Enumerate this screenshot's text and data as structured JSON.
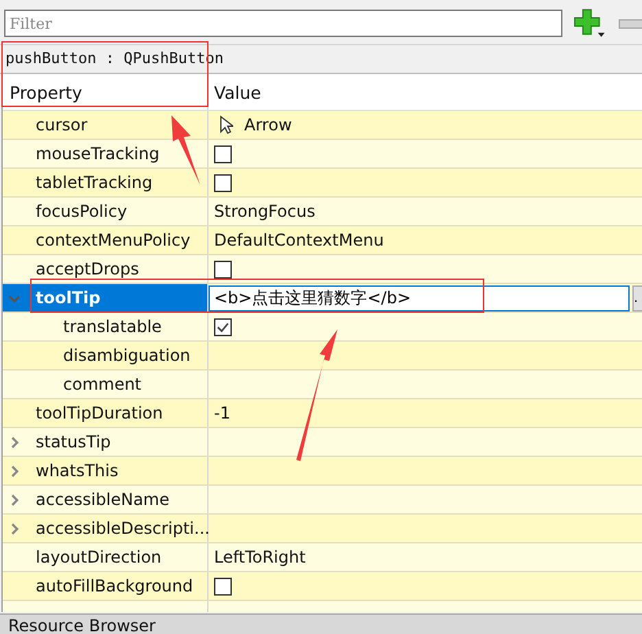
{
  "filter": {
    "placeholder": "Filter"
  },
  "object_label": "pushButton : QPushButton",
  "columns": [
    "Property",
    "Value"
  ],
  "properties": [
    {
      "name": "cursor",
      "kind": "enum",
      "value": "Arrow",
      "selected": false
    },
    {
      "name": "mouseTracking",
      "kind": "bool",
      "checked": false,
      "selected": false
    },
    {
      "name": "tabletTracking",
      "kind": "bool",
      "checked": false,
      "selected": false
    },
    {
      "name": "focusPolicy",
      "kind": "text",
      "value": "StrongFocus",
      "selected": false
    },
    {
      "name": "contextMenuPolicy",
      "kind": "text",
      "value": "DefaultContextMenu",
      "selected": false
    },
    {
      "name": "acceptDrops",
      "kind": "bool",
      "checked": false,
      "selected": false
    },
    {
      "name": "toolTip",
      "kind": "edit",
      "value": "<b>点击这里猜数字</b>",
      "button": ".",
      "selected": true,
      "expanded": true,
      "children": [
        {
          "name": "translatable",
          "kind": "bool",
          "checked": true,
          "selected": false
        },
        {
          "name": "disambiguation",
          "kind": "text",
          "selected": false
        },
        {
          "name": "comment",
          "kind": "text",
          "selected": false
        }
      ]
    },
    {
      "name": "toolTipDuration",
      "kind": "text",
      "value": "-1",
      "selected": false
    },
    {
      "name": "statusTip",
      "kind": "text",
      "selected": false,
      "expanded": false
    },
    {
      "name": "whatsThis",
      "kind": "text",
      "selected": false,
      "expanded": false
    },
    {
      "name": "accessibleName",
      "kind": "text",
      "selected": false,
      "expanded": false
    },
    {
      "name": "accessibleDescripti...",
      "kind": "text",
      "selected": false,
      "expanded": false
    },
    {
      "name": "layoutDirection",
      "kind": "text",
      "value": "LeftToRight",
      "selected": false
    },
    {
      "name": "autoFillBackground",
      "kind": "bool",
      "checked": false,
      "selected": false
    }
  ],
  "bottom_panel": {
    "title": "Resource Browser"
  }
}
